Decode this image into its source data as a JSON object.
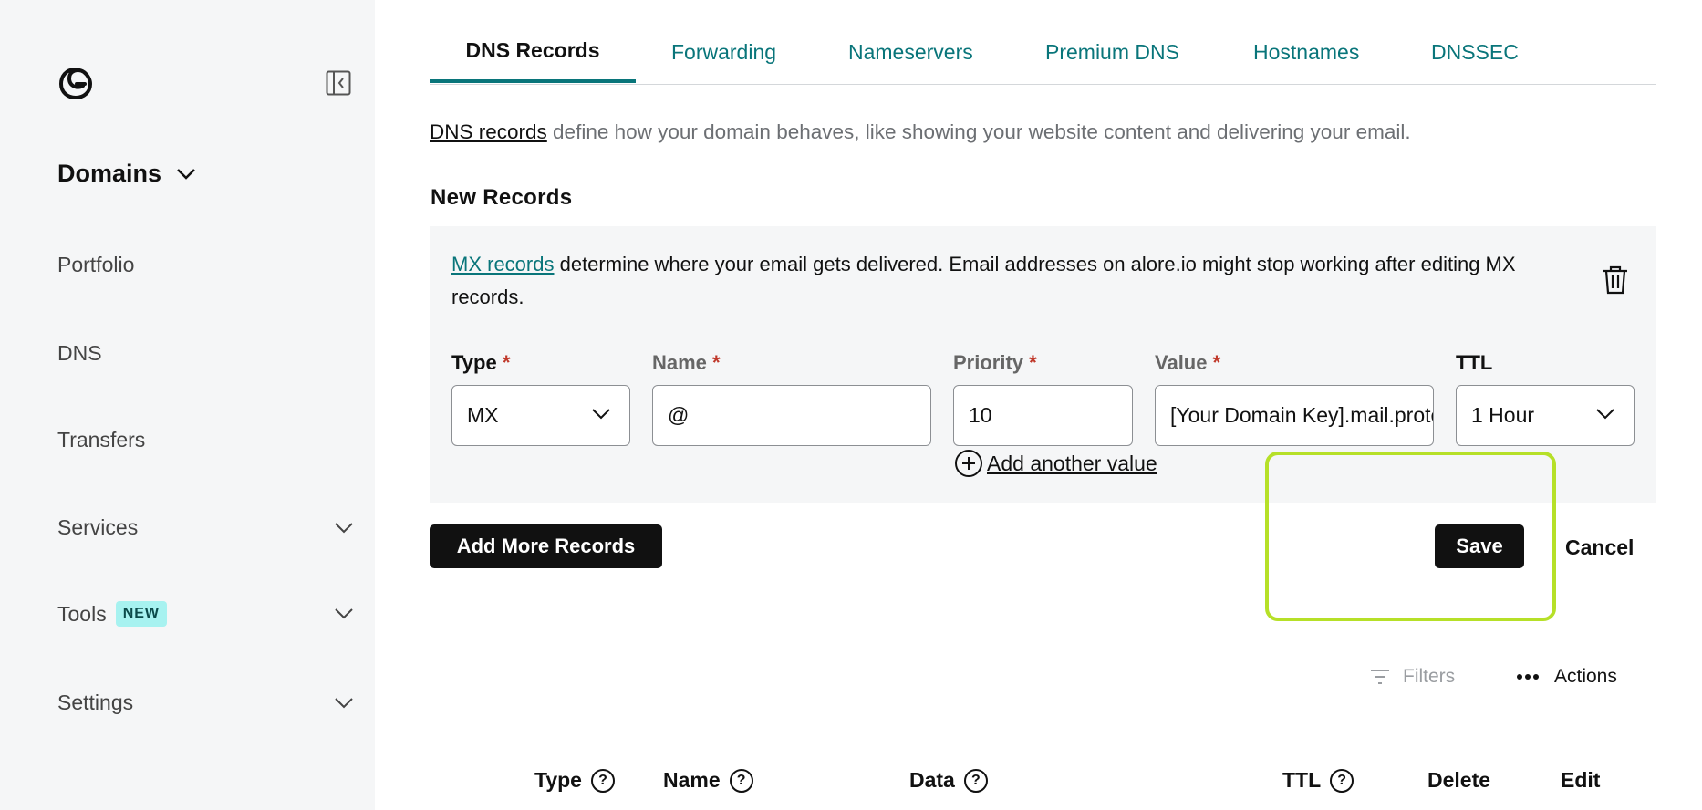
{
  "sidebar": {
    "title": "Domains",
    "items": [
      {
        "label": "Portfolio"
      },
      {
        "label": "DNS"
      },
      {
        "label": "Transfers"
      },
      {
        "label": "Services"
      },
      {
        "label": "Tools",
        "badge": "NEW"
      },
      {
        "label": "Settings"
      }
    ]
  },
  "tabs": [
    "DNS Records",
    "Forwarding",
    "Nameservers",
    "Premium DNS",
    "Hostnames",
    "DNSSEC"
  ],
  "intro": {
    "link": "DNS records",
    "text": " define how your domain behaves, like showing your website content and delivering your email."
  },
  "new_records": {
    "title": "New Records",
    "info_link": "MX records",
    "info_text": " determine where your email gets delivered. Email addresses on alore.io might stop working after editing MX records.",
    "fields": {
      "type": {
        "label": "Type",
        "value": "MX"
      },
      "name": {
        "label": "Name",
        "value": "@"
      },
      "priority": {
        "label": "Priority",
        "value": "10"
      },
      "value": {
        "label": "Value",
        "value": "[Your Domain Key].mail.protection.outlook.com"
      },
      "ttl": {
        "label": "TTL",
        "value": "1 Hour"
      }
    },
    "required_mark": "*",
    "add_value": "Add another value"
  },
  "buttons": {
    "add_more": "Add More Records",
    "save": "Save",
    "cancel": "Cancel"
  },
  "toolbar": {
    "filters": "Filters",
    "actions": "Actions"
  },
  "table": {
    "headers": [
      {
        "label": "Type",
        "help": "?"
      },
      {
        "label": "Name",
        "help": "?"
      },
      {
        "label": "Data",
        "help": "?"
      },
      {
        "label": "TTL",
        "help": "?"
      },
      {
        "label": "Delete"
      },
      {
        "label": "Edit"
      }
    ]
  },
  "colors": {
    "accent": "#09757a",
    "highlight": "#b6e028",
    "sidebar_bg": "#f5f6f7",
    "badge_bg": "#a7f2f0"
  }
}
